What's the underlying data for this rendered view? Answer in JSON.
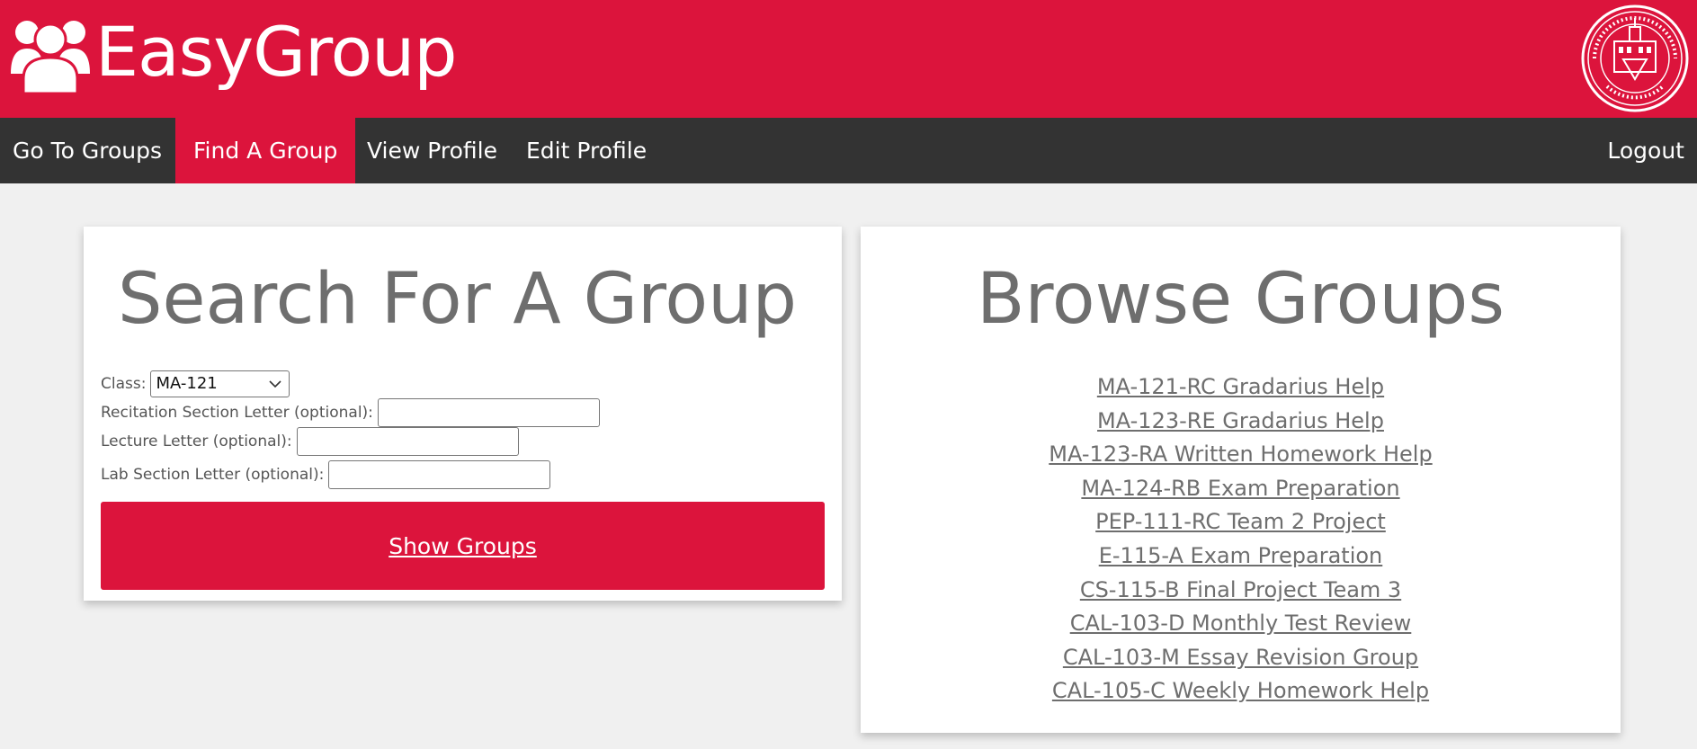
{
  "header": {
    "brand_name": "EasyGroup",
    "accent_color": "#dc143c",
    "logo_icon": "users-icon",
    "seal_icon": "university-seal-icon"
  },
  "nav": {
    "items": [
      {
        "label": "Go To Groups"
      },
      {
        "label": "Find A Group",
        "active": true
      },
      {
        "label": "View Profile"
      },
      {
        "label": "Edit Profile"
      }
    ],
    "logout_label": "Logout",
    "bar_color": "#333333"
  },
  "search": {
    "title": "Search For A Group",
    "class_label": "Class:",
    "class_value": "MA-121",
    "recitation_label": "Recitation Section Letter (optional):",
    "recitation_value": "",
    "lecture_label": "Lecture Letter (optional):",
    "lecture_value": "",
    "lab_label": "Lab Section Letter (optional):",
    "lab_value": "",
    "submit_label": "Show Groups"
  },
  "browse": {
    "title": "Browse Groups",
    "groups": [
      "MA-121-RC Gradarius Help",
      "MA-123-RE Gradarius Help",
      "MA-123-RA Written Homework Help",
      "MA-124-RB Exam Preparation",
      "PEP-111-RC Team 2 Project",
      "E-115-A Exam Preparation",
      "CS-115-B Final Project Team 3",
      "CAL-103-D Monthly Test Review",
      "CAL-103-M Essay Revision Group",
      "CAL-105-C Weekly Homework Help"
    ]
  }
}
